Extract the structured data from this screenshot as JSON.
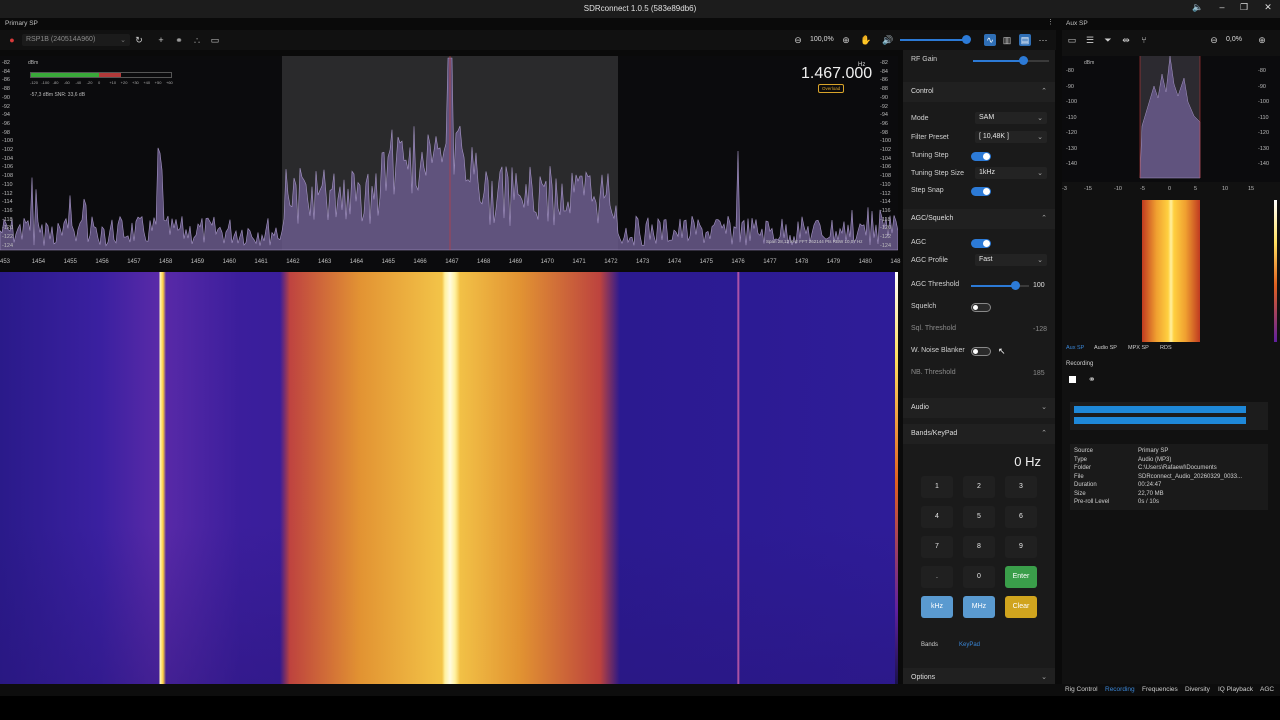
{
  "window": {
    "title": "SDRconnect 1.0.5 (583e89db6)",
    "controls": [
      "sound-icon",
      "minimize-icon",
      "restore-icon",
      "close-icon"
    ]
  },
  "primary": {
    "label": "Primary SP",
    "device": "RSP1B (240514A960)",
    "zoom": "100,0%",
    "frequency": "1.467.000",
    "freq_unit": "Hz",
    "overload": "Overload",
    "signal_info": "-57,3 dBm   SNR: 33,6 dB",
    "meter_scale": [
      "-120",
      "-100",
      "-80",
      "-60",
      "-40",
      "-20",
      "0",
      "+10",
      "+20",
      "+30",
      "+40",
      "+50",
      "+60"
    ],
    "meter_unit": "dBm",
    "db_scale": [
      "-82",
      "-84",
      "-86",
      "-88",
      "-90",
      "-92",
      "-94",
      "-96",
      "-98",
      "-100",
      "-102",
      "-104",
      "-106",
      "-108",
      "-110",
      "-112",
      "-114",
      "-116",
      "-118",
      "-120",
      "-122",
      "-124"
    ],
    "fft_info": "Span 28,12 kHz FFT 262144 Pts RBW 10,07 Hz",
    "freq_axis": [
      "453",
      "1454",
      "1455",
      "1456",
      "1457",
      "1458",
      "1459",
      "1460",
      "1461",
      "1462",
      "1463",
      "1464",
      "1465",
      "1466",
      "1467",
      "1468",
      "1469",
      "1470",
      "1471",
      "1472",
      "1473",
      "1474",
      "1475",
      "1476",
      "1477",
      "1478",
      "1479",
      "1480",
      "148"
    ]
  },
  "panel": {
    "rf_gain": "RF Gain",
    "control": "Control",
    "mode_label": "Mode",
    "mode_value": "SAM",
    "filter_label": "Filter Preset",
    "filter_value": "[ 10,48K ]",
    "tuning_step": "Tuning Step",
    "tuning_step_size": "Tuning Step Size",
    "tuning_step_size_value": "1kHz",
    "step_snap": "Step Snap",
    "agc_squelch": "AGC/Squelch",
    "agc": "AGC",
    "agc_profile": "AGC Profile",
    "agc_profile_value": "Fast",
    "agc_threshold": "AGC Threshold",
    "agc_threshold_value": "100",
    "squelch": "Squelch",
    "sql_threshold": "Sql. Threshold",
    "sql_threshold_value": "-128",
    "noise_blanker": "W. Noise Blanker",
    "nb_threshold": "NB. Threshold",
    "nb_threshold_value": "185",
    "audio": "Audio",
    "bands_keypad": "Bands/KeyPad",
    "keypad_display": "0 Hz",
    "keys": [
      "1",
      "2",
      "3",
      "4",
      "5",
      "6",
      "7",
      "8",
      "9",
      ".",
      "0",
      "Enter",
      "kHz",
      "MHz",
      "Clear"
    ],
    "bands_tab": "Bands",
    "keypad_tab": "KeyPad",
    "options": "Options"
  },
  "aux": {
    "label": "Aux SP",
    "zoom": "0,0%",
    "unit": "dBm",
    "db_left": [
      "-80",
      "-90",
      "-100",
      "-110",
      "-120",
      "-130",
      "-140"
    ],
    "db_right": [
      "-80",
      "-90",
      "-100",
      "-110",
      "-120",
      "-130",
      "-140"
    ],
    "x_axis": [
      "-3",
      "-15",
      "-10",
      "-5",
      "0",
      "5",
      "10",
      "15"
    ],
    "tabs": [
      "Aux SP",
      "Audio SP",
      "MPX SP",
      "RDS"
    ],
    "recording": "Recording",
    "info": [
      {
        "k": "Source",
        "v": "Primary SP"
      },
      {
        "k": "Type",
        "v": "Audio (MP3)"
      },
      {
        "k": "Folder",
        "v": "C:\\Users\\Rafaewl\\Documents"
      },
      {
        "k": "File",
        "v": "SDRconnect_Audio_20260329_0033..."
      },
      {
        "k": "Duration",
        "v": "00:24:47"
      },
      {
        "k": "Size",
        "v": "22,70 MB"
      },
      {
        "k": "Pre-roll Level",
        "v": "0s / 10s"
      }
    ]
  },
  "statusbar": {
    "tabs": [
      "Rig Control",
      "Recording",
      "Frequencies",
      "Diversity",
      "IQ Playback",
      "AGC"
    ]
  }
}
